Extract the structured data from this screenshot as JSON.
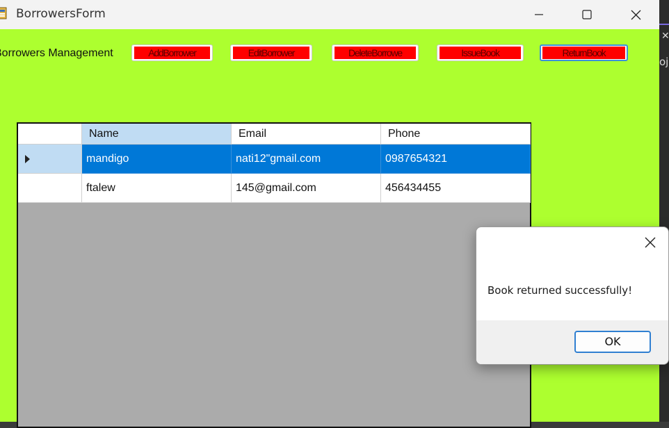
{
  "window": {
    "title": "BorrowersForm"
  },
  "background_app": {
    "close_glyph": "✕",
    "snippet": "oj"
  },
  "header": {
    "title": "Borrowers Management"
  },
  "toolbar": {
    "add_label": "AddBorrower",
    "edit_label": "EditBorrower",
    "delete_label": "DeleteBorrowe",
    "issue_label": "IssueBook",
    "return_label": "ReturnBook"
  },
  "grid": {
    "columns": [
      "Name",
      "Email",
      "Phone"
    ],
    "rows": [
      {
        "name": "mandigo",
        "email": "nati12\"gmail.com",
        "phone": "0987654321"
      },
      {
        "name": "ftalew",
        "email": "145@gmail.com",
        "phone": "456434455"
      }
    ],
    "selected_row": 0
  },
  "dialog": {
    "message": "Book returned successfully!",
    "ok_label": "OK"
  },
  "colors": {
    "form_background": "#adff2f",
    "button_fill": "#ff0000",
    "selection": "#0078d7",
    "grid_background": "#ababab"
  },
  "icons": {
    "app": "app-form-icon",
    "minimize": "minimize-icon",
    "maximize": "maximize-icon",
    "close": "close-icon",
    "row_pointer": "row-pointer-icon"
  }
}
